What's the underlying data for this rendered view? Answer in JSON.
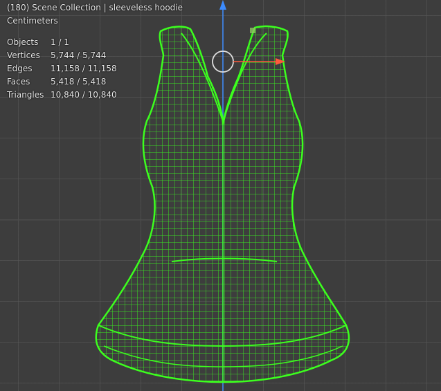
{
  "viewport": {
    "header": "(180) Scene Collection | sleeveless hoodie",
    "units": "Centimeters",
    "stats": [
      {
        "label": "Objects",
        "value": "1 / 1"
      },
      {
        "label": "Vertices",
        "value": "5,744 / 5,744"
      },
      {
        "label": "Edges",
        "value": "11,158 / 11,158"
      },
      {
        "label": "Faces",
        "value": "5,418 / 5,418"
      },
      {
        "label": "Triangles",
        "value": "10,840 / 10,840"
      }
    ]
  },
  "colors": {
    "background": "#3d3d3d",
    "grid": "#5a5a5a",
    "wireframe": "#3cff1e",
    "z_axis": "#3c8cff",
    "x_axis": "#ff5a3c"
  },
  "icons": [
    "z-axis-arrow-icon",
    "gizmo-x-arrow-icon",
    "gizmo-circle-icon",
    "object-origin-icon"
  ]
}
